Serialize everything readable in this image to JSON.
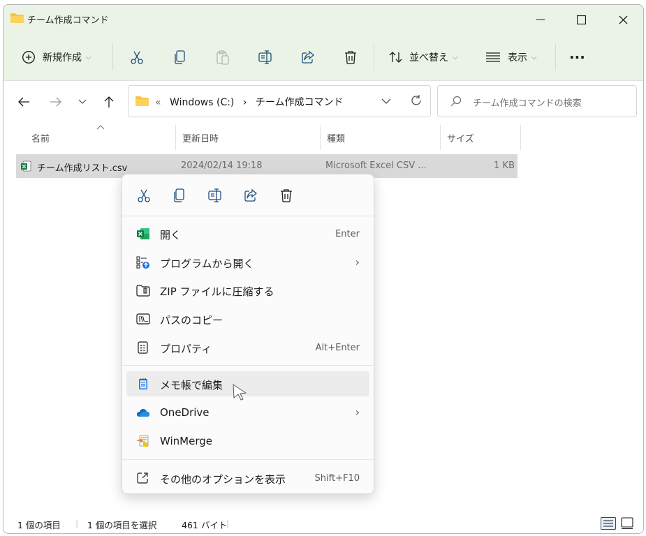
{
  "window": {
    "title": "チーム作成コマンド",
    "controls": {
      "minimize": "—",
      "maximize": "☐",
      "close": "✕"
    }
  },
  "toolbar": {
    "new_label": "新規作成",
    "sort_label": "並べ替え",
    "view_label": "表示",
    "more_label": "···"
  },
  "address": {
    "overflow": "«",
    "crumbs": [
      "Windows (C:)",
      "›",
      "チーム作成コマンド"
    ],
    "search_placeholder": "チーム作成コマンドの検索"
  },
  "columns": {
    "name": "名前",
    "modified": "更新日時",
    "type": "種類",
    "size": "サイズ"
  },
  "file": {
    "name": "チーム作成リスト.csv",
    "modified": "2024/02/14 19:18",
    "type": "Microsoft Excel CSV ...",
    "size": "1 KB"
  },
  "context_menu": {
    "items": [
      {
        "label": "開く",
        "accelerator": "Enter",
        "icon": "excel-icon"
      },
      {
        "label": "プログラムから開く",
        "submenu": "›",
        "icon": "open-with-icon"
      },
      {
        "label": "ZIP ファイルに圧縮する",
        "icon": "zip-icon"
      },
      {
        "label": "パスのコピー",
        "icon": "copy-path-icon"
      },
      {
        "label": "プロパティ",
        "accelerator": "Alt+Enter",
        "icon": "properties-icon"
      },
      {
        "label": "メモ帳で編集",
        "icon": "notepad-icon"
      },
      {
        "label": "OneDrive",
        "submenu": "›",
        "icon": "onedrive-icon"
      },
      {
        "label": "WinMerge",
        "icon": "winmerge-icon"
      },
      {
        "label": "その他のオプションを表示",
        "accelerator": "Shift+F10",
        "icon": "more-options-icon"
      }
    ]
  },
  "status": {
    "count": "1 個の項目",
    "selected": "1 個の項目を選択",
    "size": "461 バイト"
  },
  "colors": {
    "accent_bg": "#eaf3e6",
    "selection": "#d9d9d9",
    "folder": "#f8c43a"
  }
}
